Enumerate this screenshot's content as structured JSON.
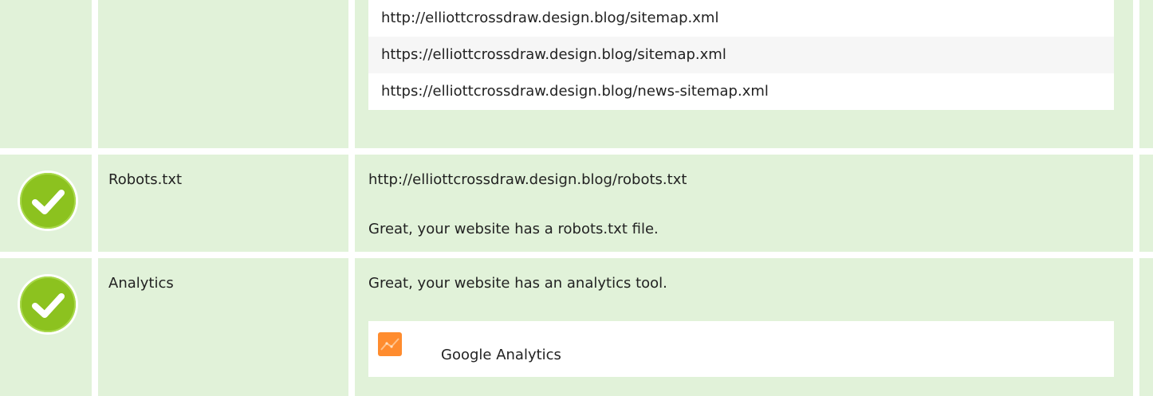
{
  "sitemaps": {
    "items": [
      "http://elliottcrossdraw.design.blog/sitemap.xml",
      "https://elliottcrossdraw.design.blog/sitemap.xml",
      "https://elliottcrossdraw.design.blog/news-sitemap.xml"
    ]
  },
  "robots": {
    "status_icon": "check-circle-icon",
    "label": "Robots.txt",
    "url": "http://elliottcrossdraw.design.blog/robots.txt",
    "message": "Great, your website has a robots.txt file."
  },
  "analytics": {
    "status_icon": "check-circle-icon",
    "label": "Analytics",
    "message": "Great, your website has an analytics tool.",
    "tools": [
      {
        "name": "Google Analytics",
        "icon": "google-analytics-icon"
      }
    ]
  },
  "colors": {
    "row_background": "#e1f2d9",
    "check_green": "#8cc21f",
    "analytics_orange": "#ff8c2e"
  }
}
